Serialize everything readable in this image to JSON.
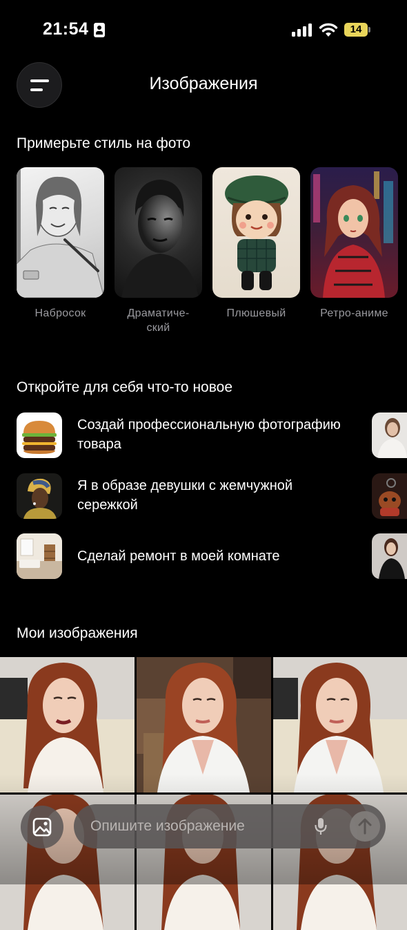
{
  "status_bar": {
    "time": "21:54",
    "battery": "14",
    "battery_color": "#e9d55a"
  },
  "header": {
    "title": "Изображения"
  },
  "styles_section": {
    "title": "Примерьте стиль на фото",
    "items": [
      {
        "label": "Набросок"
      },
      {
        "label": "Драматиче-\nский"
      },
      {
        "label": "Плюшевый"
      },
      {
        "label": "Ретро-аниме"
      }
    ]
  },
  "discover_section": {
    "title": "Откройте для себя что-то новое",
    "items": [
      {
        "text": "Создай профессиональную фотографию товара",
        "icon": "burger-image"
      },
      {
        "text": "Я в образе девушки с жемчужной сережкой",
        "icon": "pearl-earring-portrait"
      },
      {
        "text": "Сделай ремонт в моей комнате",
        "icon": "room-interior-image"
      }
    ]
  },
  "gallery_section": {
    "title": "Мои изображения"
  },
  "composer": {
    "placeholder": "Опишите изображение",
    "image_icon": "image-icon",
    "mic_icon": "microphone-icon",
    "send_icon": "arrow-up-icon"
  }
}
